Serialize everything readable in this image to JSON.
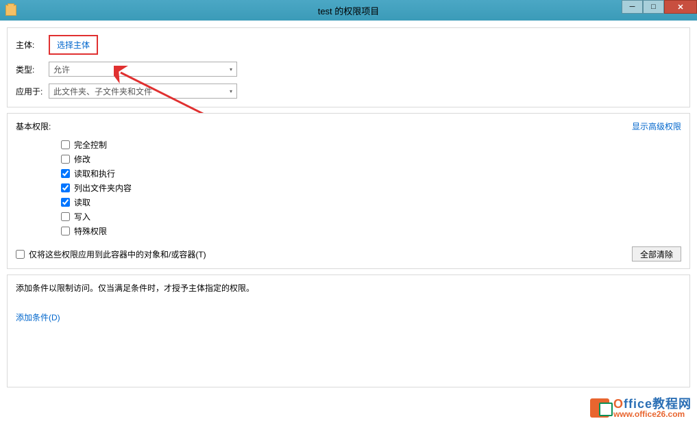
{
  "titlebar": {
    "title": "test 的权限项目"
  },
  "principal": {
    "label": "主体:",
    "select_link": "选择主体"
  },
  "type": {
    "label": "类型:",
    "value": "允许"
  },
  "applies_to": {
    "label": "应用于:",
    "value": "此文件夹、子文件夹和文件"
  },
  "permissions": {
    "title": "基本权限:",
    "show_advanced": "显示高级权限",
    "items": [
      {
        "label": "完全控制",
        "checked": false
      },
      {
        "label": "修改",
        "checked": false
      },
      {
        "label": "读取和执行",
        "checked": true
      },
      {
        "label": "列出文件夹内容",
        "checked": true
      },
      {
        "label": "读取",
        "checked": true
      },
      {
        "label": "写入",
        "checked": false
      },
      {
        "label": "特殊权限",
        "checked": false
      }
    ],
    "only_apply_label": "仅将这些权限应用到此容器中的对象和/或容器(T)",
    "clear_all": "全部清除"
  },
  "conditions": {
    "description": "添加条件以限制访问。仅当满足条件时，才授予主体指定的权限。",
    "add_link": "添加条件(D)"
  },
  "watermark": {
    "brand_first": "O",
    "brand_rest": "ffice教程网",
    "url": "www.office26.com"
  }
}
